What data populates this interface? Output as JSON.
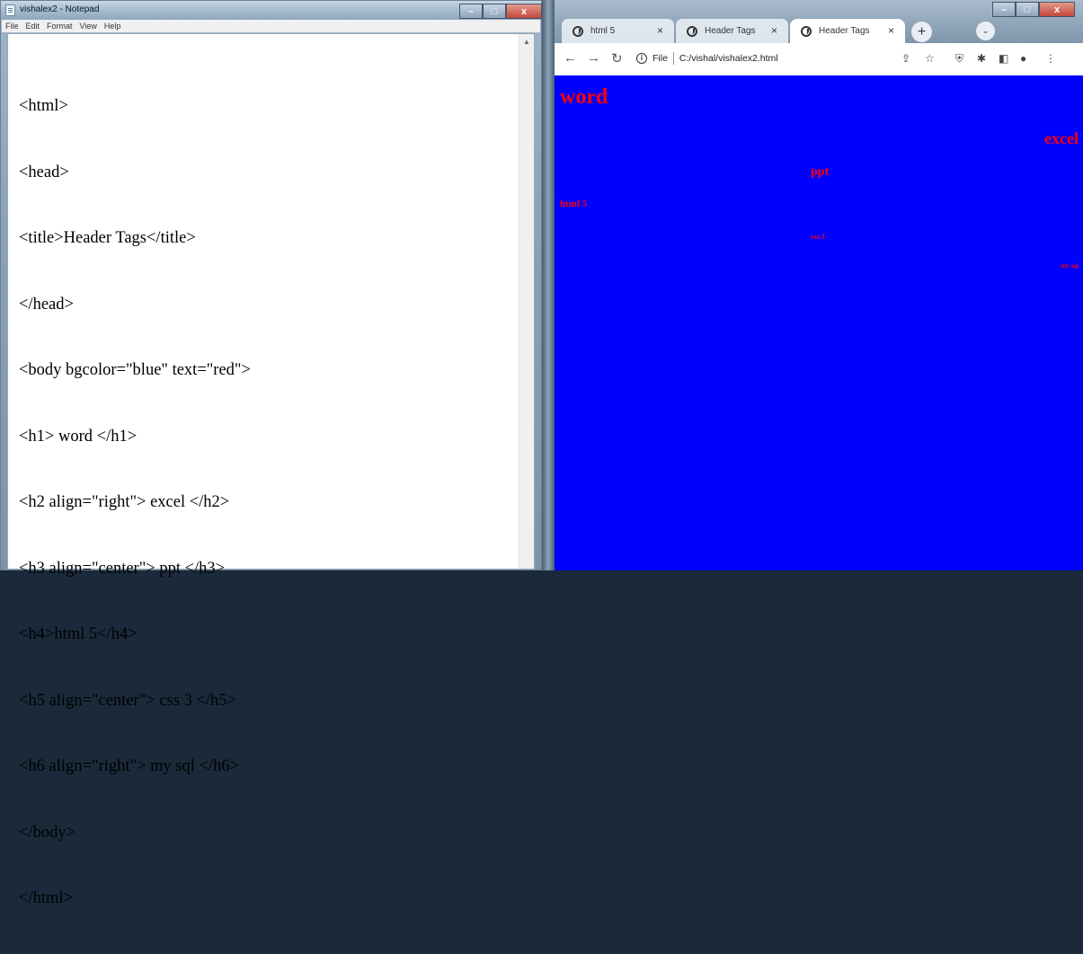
{
  "notepad": {
    "title": "vishalex2 - Notepad",
    "menu": [
      "File",
      "Edit",
      "Format",
      "View",
      "Help"
    ],
    "window_buttons": [
      "–",
      "□",
      "x"
    ],
    "lines": [
      "<html>",
      "<head>",
      "<title>Header Tags</title>",
      "</head>",
      "<body bgcolor=\"blue\" text=\"red\">",
      "<h1> word </h1>",
      "<h2 align=\"right\"> excel </h2>",
      "<h3 align=\"center\"> ppt </h3>",
      "<h4>html 5</h4>",
      "<h5 align=\"center\"> css 3 </h5>",
      "<h6 align=\"right\"> my sql </h6>",
      "</body>",
      "</html>"
    ]
  },
  "browser": {
    "tabs": [
      {
        "label": "html 5",
        "close": "×"
      },
      {
        "label": "Header Tags",
        "close": "×"
      },
      {
        "label": "Header Tags",
        "close": "×"
      }
    ],
    "new_tab": "+",
    "window_buttons": [
      "–",
      "□",
      "x"
    ],
    "address": {
      "scheme": "File",
      "url": "C:/vishal/vishalex2.html"
    },
    "page": {
      "bgcolor": "#0000ff",
      "text_color": "#ff0000",
      "h1": "word",
      "h2": "excel",
      "h3": "ppt",
      "h4": "html 5",
      "h5": "css 3",
      "h6": "my sql"
    }
  }
}
